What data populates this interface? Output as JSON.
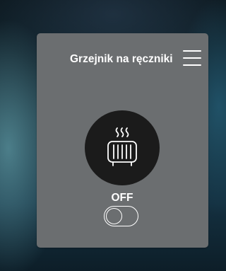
{
  "widget": {
    "title": "Grzejnik na ręczniki",
    "state_label": "OFF",
    "is_on": false,
    "icon": "radiator-heat-icon",
    "menu_icon": "hamburger-menu-icon"
  },
  "colors": {
    "card_background": "#6b6e70",
    "icon_circle": "#1b1b1b",
    "foreground": "#ffffff"
  }
}
